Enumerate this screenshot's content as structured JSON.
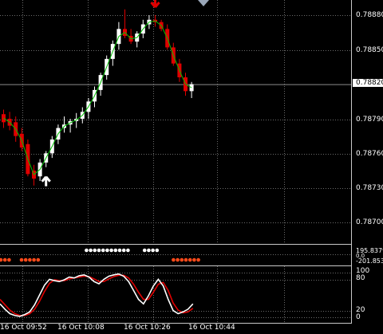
{
  "chart_data": {
    "type": "candlestick",
    "symbol_axis": {
      "price_ticks": [
        "0.78880",
        "0.78850",
        "0.78790",
        "0.78760",
        "0.78730",
        "0.78700"
      ],
      "current_price": "0.78820"
    },
    "time_labels": [
      "16 Oct 09:52",
      "16 Oct 10:08",
      "16 Oct 10:26",
      "16 Oct 10:44"
    ],
    "candles": [
      {
        "o": 0.78794,
        "h": 0.78798,
        "l": 0.78782,
        "c": 0.78787,
        "dir": "down"
      },
      {
        "o": 0.7879,
        "h": 0.78796,
        "l": 0.7878,
        "c": 0.78784,
        "dir": "down"
      },
      {
        "o": 0.78787,
        "h": 0.78792,
        "l": 0.7877,
        "c": 0.78775,
        "dir": "down"
      },
      {
        "o": 0.78777,
        "h": 0.78782,
        "l": 0.78762,
        "c": 0.78765,
        "dir": "down"
      },
      {
        "o": 0.78768,
        "h": 0.78772,
        "l": 0.7874,
        "c": 0.78742,
        "dir": "down"
      },
      {
        "o": 0.78745,
        "h": 0.7875,
        "l": 0.78732,
        "c": 0.78738,
        "dir": "down"
      },
      {
        "o": 0.7874,
        "h": 0.78755,
        "l": 0.78736,
        "c": 0.78752,
        "dir": "up"
      },
      {
        "o": 0.78752,
        "h": 0.78762,
        "l": 0.78748,
        "c": 0.7876,
        "dir": "up"
      },
      {
        "o": 0.7876,
        "h": 0.78775,
        "l": 0.78756,
        "c": 0.78772,
        "dir": "up"
      },
      {
        "o": 0.78772,
        "h": 0.78785,
        "l": 0.78768,
        "c": 0.78782,
        "dir": "up"
      },
      {
        "o": 0.78782,
        "h": 0.78792,
        "l": 0.78778,
        "c": 0.78785,
        "dir": "up"
      },
      {
        "o": 0.78785,
        "h": 0.7879,
        "l": 0.78778,
        "c": 0.78788,
        "dir": "up"
      },
      {
        "o": 0.78788,
        "h": 0.78795,
        "l": 0.78782,
        "c": 0.7879,
        "dir": "up"
      },
      {
        "o": 0.7879,
        "h": 0.788,
        "l": 0.78786,
        "c": 0.78796,
        "dir": "up"
      },
      {
        "o": 0.78796,
        "h": 0.78808,
        "l": 0.7879,
        "c": 0.78805,
        "dir": "up"
      },
      {
        "o": 0.78805,
        "h": 0.78818,
        "l": 0.788,
        "c": 0.78815,
        "dir": "up"
      },
      {
        "o": 0.78815,
        "h": 0.7883,
        "l": 0.7881,
        "c": 0.78828,
        "dir": "up"
      },
      {
        "o": 0.78828,
        "h": 0.78845,
        "l": 0.78824,
        "c": 0.78842,
        "dir": "up"
      },
      {
        "o": 0.78842,
        "h": 0.78858,
        "l": 0.78836,
        "c": 0.78855,
        "dir": "up"
      },
      {
        "o": 0.78855,
        "h": 0.78874,
        "l": 0.7885,
        "c": 0.78868,
        "dir": "up"
      },
      {
        "o": 0.78868,
        "h": 0.78885,
        "l": 0.7886,
        "c": 0.78862,
        "dir": "down"
      },
      {
        "o": 0.78862,
        "h": 0.78868,
        "l": 0.78855,
        "c": 0.78857,
        "dir": "down"
      },
      {
        "o": 0.78857,
        "h": 0.78866,
        "l": 0.78852,
        "c": 0.78864,
        "dir": "up"
      },
      {
        "o": 0.78864,
        "h": 0.78876,
        "l": 0.7886,
        "c": 0.78872,
        "dir": "up"
      },
      {
        "o": 0.78872,
        "h": 0.7888,
        "l": 0.78868,
        "c": 0.78876,
        "dir": "up"
      },
      {
        "o": 0.78876,
        "h": 0.7888,
        "l": 0.7887,
        "c": 0.78874,
        "dir": "down"
      },
      {
        "o": 0.78874,
        "h": 0.78876,
        "l": 0.78866,
        "c": 0.78868,
        "dir": "down"
      },
      {
        "o": 0.78868,
        "h": 0.78872,
        "l": 0.7885,
        "c": 0.78852,
        "dir": "down"
      },
      {
        "o": 0.78852,
        "h": 0.78856,
        "l": 0.78836,
        "c": 0.78838,
        "dir": "down"
      },
      {
        "o": 0.78838,
        "h": 0.78842,
        "l": 0.78822,
        "c": 0.78826,
        "dir": "down"
      },
      {
        "o": 0.78826,
        "h": 0.7883,
        "l": 0.7881,
        "c": 0.78814,
        "dir": "down"
      },
      {
        "o": 0.78814,
        "h": 0.78822,
        "l": 0.78808,
        "c": 0.7882,
        "dir": "up"
      }
    ],
    "signals": [
      {
        "type": "buy",
        "candle": 7
      },
      {
        "type": "sell",
        "candle": 25
      }
    ],
    "middle_indicator": {
      "values": [
        "195.8379",
        "-201.853",
        "0.0"
      ],
      "dots_white": [
        17,
        18,
        19,
        20,
        21,
        22,
        23,
        24,
        25,
        26,
        27,
        31,
        32,
        33,
        34
      ],
      "dots_red_left": [
        0,
        1,
        2,
        5,
        6,
        7,
        8,
        9
      ],
      "dots_red_right": [
        37,
        38,
        39,
        40,
        41,
        42,
        43
      ]
    },
    "stochastic": {
      "levels": [
        "100",
        "80",
        "20",
        "0"
      ],
      "main": [
        30,
        18,
        8,
        4,
        2,
        6,
        12,
        28,
        50,
        72,
        85,
        82,
        80,
        84,
        90,
        88,
        93,
        95,
        90,
        80,
        75,
        85,
        92,
        95,
        97,
        92,
        80,
        60,
        40,
        30,
        48,
        70,
        85,
        70,
        40,
        15,
        8,
        12,
        18,
        30
      ],
      "signal": [
        40,
        28,
        16,
        8,
        4,
        4,
        8,
        18,
        36,
        58,
        76,
        84,
        82,
        82,
        86,
        88,
        90,
        92,
        91,
        86,
        80,
        80,
        86,
        91,
        94,
        94,
        88,
        74,
        56,
        40,
        40,
        56,
        74,
        78,
        60,
        32,
        16,
        10,
        12,
        20
      ]
    }
  },
  "colors": {
    "bull": "#ffffff",
    "bear": "#e00000",
    "ma": "#00c000",
    "stoch_main": "#ffffff",
    "stoch_signal": "#e00000",
    "grid": "#6b6b6b",
    "bid_line": "#8c8c8c"
  }
}
